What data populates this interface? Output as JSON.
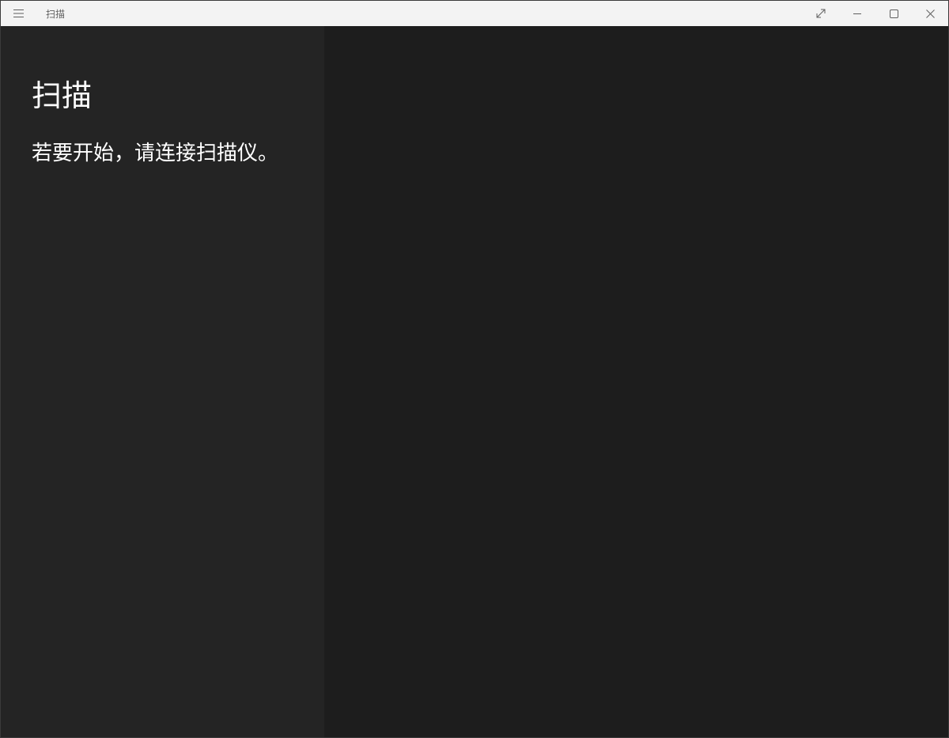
{
  "window": {
    "title": "扫描",
    "buttons": {
      "compact_icon": "compact-overlay-icon",
      "minimize_icon": "minimize-icon",
      "maximize_icon": "maximize-icon",
      "close_icon": "close-icon"
    },
    "menu_icon": "hamburger-menu-icon"
  },
  "main": {
    "title": "扫描",
    "message": "若要开始，请连接扫描仪。"
  },
  "colors": {
    "titlebar": "#f3f3f3",
    "left_pane": "#242424",
    "right_pane": "#1d1d1d",
    "text": "#ffffff"
  }
}
